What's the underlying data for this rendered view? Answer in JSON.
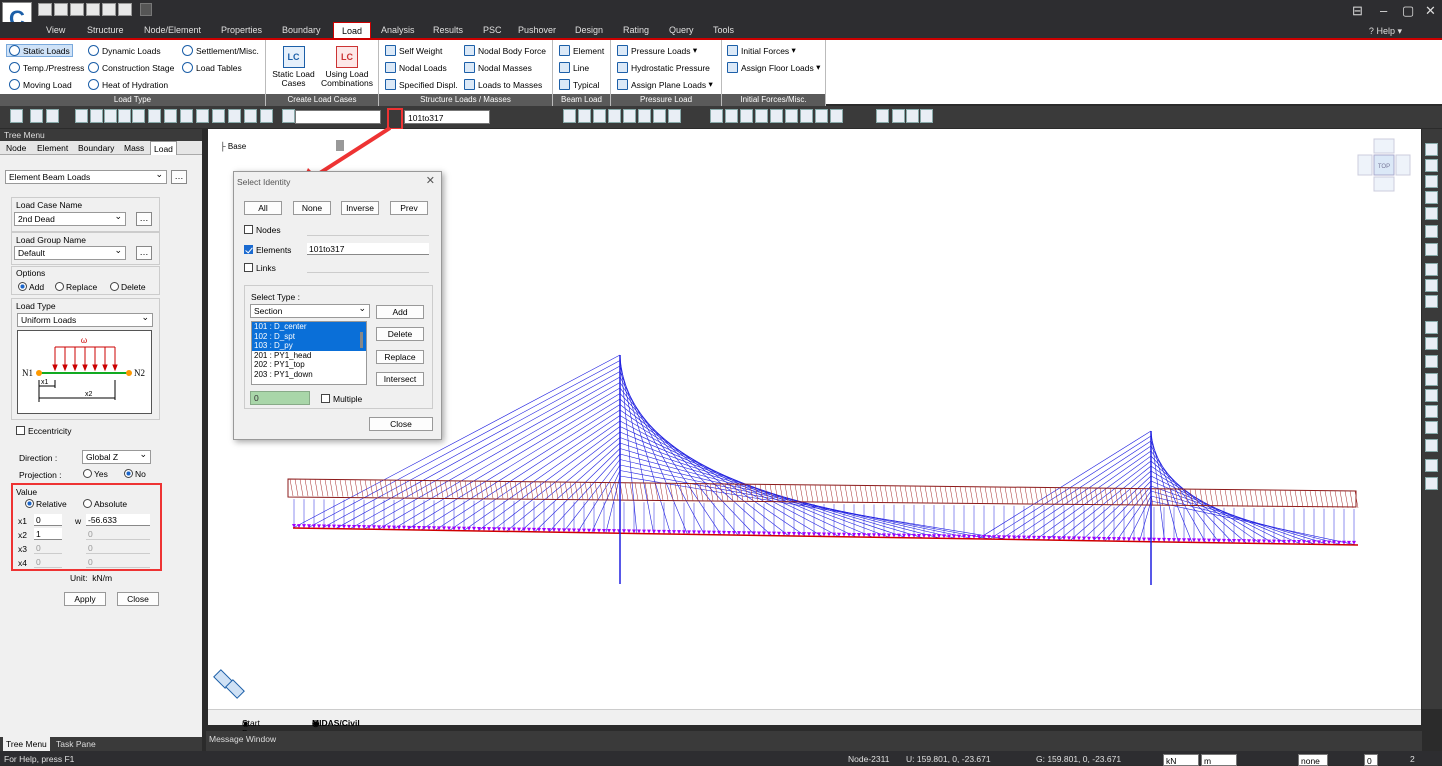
{
  "menu_tabs": [
    "View",
    "Structure",
    "Node/Element",
    "Properties",
    "Boundary",
    "Load",
    "Analysis",
    "Results",
    "PSC",
    "Pushover",
    "Design",
    "Rating",
    "Query",
    "Tools"
  ],
  "help_label": "Help",
  "ribbon": {
    "load_type": {
      "items": [
        "Static Loads",
        "Dynamic Loads",
        "Settlement/Misc.",
        "Temp./Prestress",
        "Construction Stage",
        "Load Tables",
        "Moving Load",
        "Heat of Hydration"
      ],
      "title": "Load Type"
    },
    "create_load_cases": {
      "static": "Static Load Cases",
      "combo": "Using Load Combinations",
      "title": "Create Load Cases",
      "lc": "LC"
    },
    "structure_loads": {
      "items": [
        "Self Weight",
        "Nodal Body Force",
        "Nodal Loads",
        "Nodal Masses",
        "Specified Displ.",
        "Loads to Masses"
      ],
      "title": "Structure Loads / Masses"
    },
    "beam_load": {
      "items": [
        "Element",
        "Line",
        "Typical"
      ],
      "title": "Beam Load"
    },
    "pressure_load": {
      "items": [
        "Pressure Loads",
        "Hydrostatic Pressure",
        "Assign Plane Loads"
      ],
      "title": "Pressure Load"
    },
    "initial_forces": {
      "items": [
        "Initial Forces",
        "Assign Floor Loads"
      ],
      "title": "Initial Forces/Misc."
    }
  },
  "toolbar": {
    "selection_value": "101to317"
  },
  "tree_menu": {
    "title": "Tree Menu",
    "tabs": [
      "Node",
      "Element",
      "Boundary",
      "Mass",
      "Load"
    ],
    "function": "Element Beam Loads",
    "load_case_label": "Load Case Name",
    "load_case": "2nd Dead",
    "load_group_label": "Load Group Name",
    "load_group": "Default",
    "options_label": "Options",
    "options": [
      "Add",
      "Replace",
      "Delete"
    ],
    "load_type_label": "Load Type",
    "load_type": "Uniform Loads",
    "diagram": {
      "w": "ω",
      "n1": "N1",
      "n2": "N2",
      "x1": "x1",
      "x2": "x2"
    },
    "eccentricity": "Eccentricity",
    "direction_label": "Direction :",
    "direction": "Global Z",
    "projection_label": "Projection :",
    "projection_options": [
      "Yes",
      "No"
    ],
    "value_label": "Value",
    "value_modes": [
      "Relative",
      "Absolute"
    ],
    "rows": [
      {
        "label": "x1",
        "x": "0",
        "w": "-56.633",
        "w_label": "w"
      },
      {
        "label": "x2",
        "x": "1",
        "w": "0"
      },
      {
        "label": "x3",
        "x": "0",
        "w": "0"
      },
      {
        "label": "x4",
        "x": "0",
        "w": "0"
      }
    ],
    "unit_label": "Unit:",
    "unit": "kN/m",
    "apply": "Apply",
    "close": "Close",
    "bottom_tabs": [
      "Tree Menu",
      "Task Pane"
    ]
  },
  "canvas": {
    "ucs_label": "Base",
    "view_cube": "TOP"
  },
  "dialog": {
    "title": "Select Identity",
    "buttons": [
      "All",
      "None",
      "Inverse",
      "Prev"
    ],
    "nodes_label": "Nodes",
    "elements_label": "Elements",
    "elements_value": "101to317",
    "links_label": "Links",
    "select_type_label": "Select Type :",
    "select_type": "Section",
    "list": [
      {
        "text": "101  : D_center",
        "selected": true
      },
      {
        "text": "102  : D_spt",
        "selected": true
      },
      {
        "text": "103  : D_py",
        "selected": true
      },
      {
        "text": "201  : PY1_head",
        "selected": false
      },
      {
        "text": "202  : PY1_top",
        "selected": false
      },
      {
        "text": "203  : PY1_down",
        "selected": false
      }
    ],
    "side_buttons": [
      "Add",
      "Delete",
      "Replace",
      "Intersect"
    ],
    "count": "0",
    "multiple_label": "Multiple",
    "close": "Close"
  },
  "doc_tabs": [
    "Start Page",
    "MIDAS/Civil"
  ],
  "message_window": "Message Window",
  "status": {
    "help": "For Help, press F1",
    "node": "Node-2311",
    "u": "U: 159.801, 0, -23.671",
    "g": "G: 159.801, 0, -23.671",
    "force_unit": "kN",
    "length_unit": "m",
    "snap": "none",
    "page_a": "0",
    "page_b": "2"
  },
  "colors": {
    "accent": "#cc0000",
    "selection": "#0a6fd8",
    "cable": "#2020e0",
    "deck_load": "#a000ff",
    "highlight": "#ee3333"
  }
}
